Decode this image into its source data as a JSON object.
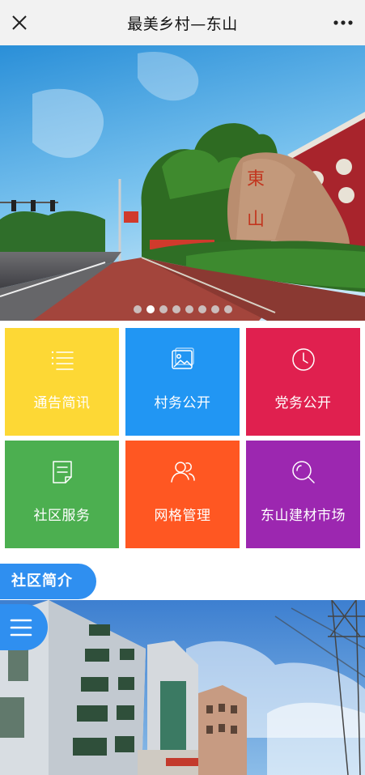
{
  "header": {
    "title": "最美乡村—东山",
    "close_icon": "close-icon",
    "more_icon": "more-icon"
  },
  "banner": {
    "slide_count": 8,
    "active_slide": 2
  },
  "menu": {
    "items": [
      {
        "label": "通告简讯",
        "icon": "list-icon",
        "color": "#fdd835"
      },
      {
        "label": "村务公开",
        "icon": "image-icon",
        "color": "#2196f3"
      },
      {
        "label": "党务公开",
        "icon": "clock-icon",
        "color": "#e0204f"
      },
      {
        "label": "社区服务",
        "icon": "document-icon",
        "color": "#4caf50"
      },
      {
        "label": "网格管理",
        "icon": "users-icon",
        "color": "#ff5722"
      },
      {
        "label": "东山建材市场",
        "icon": "search-icon",
        "color": "#9c27b0"
      }
    ]
  },
  "section": {
    "title": "社区简介"
  },
  "fab": {
    "icon": "menu-icon",
    "color": "#2f8ff0"
  }
}
